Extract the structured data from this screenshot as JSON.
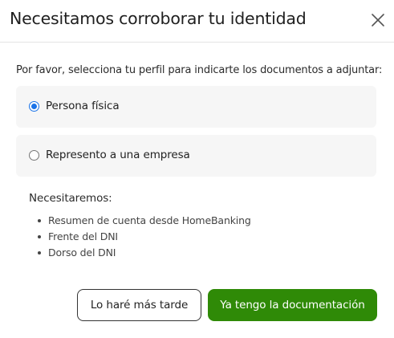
{
  "dialog": {
    "title": "Necesitamos corroborar tu identidad",
    "close_icon": "close-icon"
  },
  "profile": {
    "prompt": "Por favor, selecciona tu perfil para indicarte los documentos a adjuntar:",
    "options": [
      {
        "label": "Persona física",
        "selected": true
      },
      {
        "label": "Represento a una empresa",
        "selected": false
      }
    ]
  },
  "requirements": {
    "title": "Necesitaremos:",
    "items": [
      "Resumen de cuenta desde HomeBanking",
      "Frente del DNI",
      "Dorso del DNI"
    ]
  },
  "actions": {
    "later_label": "Lo haré más tarde",
    "done_label": "Ya tengo la documentación"
  },
  "colors": {
    "primary_button": "#2f8a07",
    "radio_accent": "#1a73e8",
    "option_background": "#f6f6f6"
  }
}
